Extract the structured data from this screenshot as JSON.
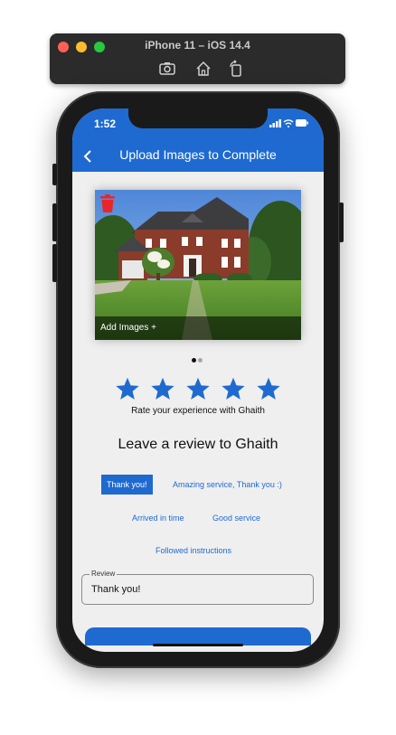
{
  "simulator": {
    "title": "iPhone 11 – iOS 14.4",
    "toolbar_icons": [
      "screenshot-icon",
      "home-icon",
      "rotate-icon"
    ]
  },
  "status_bar": {
    "time": "1:52"
  },
  "nav": {
    "title": "Upload Images to Complete",
    "back_icon": "chevron-left-icon"
  },
  "image_card": {
    "delete_icon": "trash-icon",
    "add_images_label": "Add Images +",
    "page_count": 2,
    "current_page": 1
  },
  "rating": {
    "stars_total": 5,
    "stars_selected": 5,
    "prompt": "Rate your experience with Ghaith"
  },
  "review": {
    "heading": "Leave a review to Ghaith",
    "chips": [
      {
        "label": "Thank you!",
        "selected": true
      },
      {
        "label": "Amazing service, Thank you :)",
        "selected": false
      },
      {
        "label": "Arrived in time",
        "selected": false
      },
      {
        "label": "Good service",
        "selected": false
      },
      {
        "label": "Followed instructions",
        "selected": false
      }
    ],
    "field_label": "Review",
    "field_value": "Thank you!"
  },
  "colors": {
    "accent": "#1e6ad1",
    "delete": "#e8262a",
    "screen_bg": "#efefef"
  }
}
